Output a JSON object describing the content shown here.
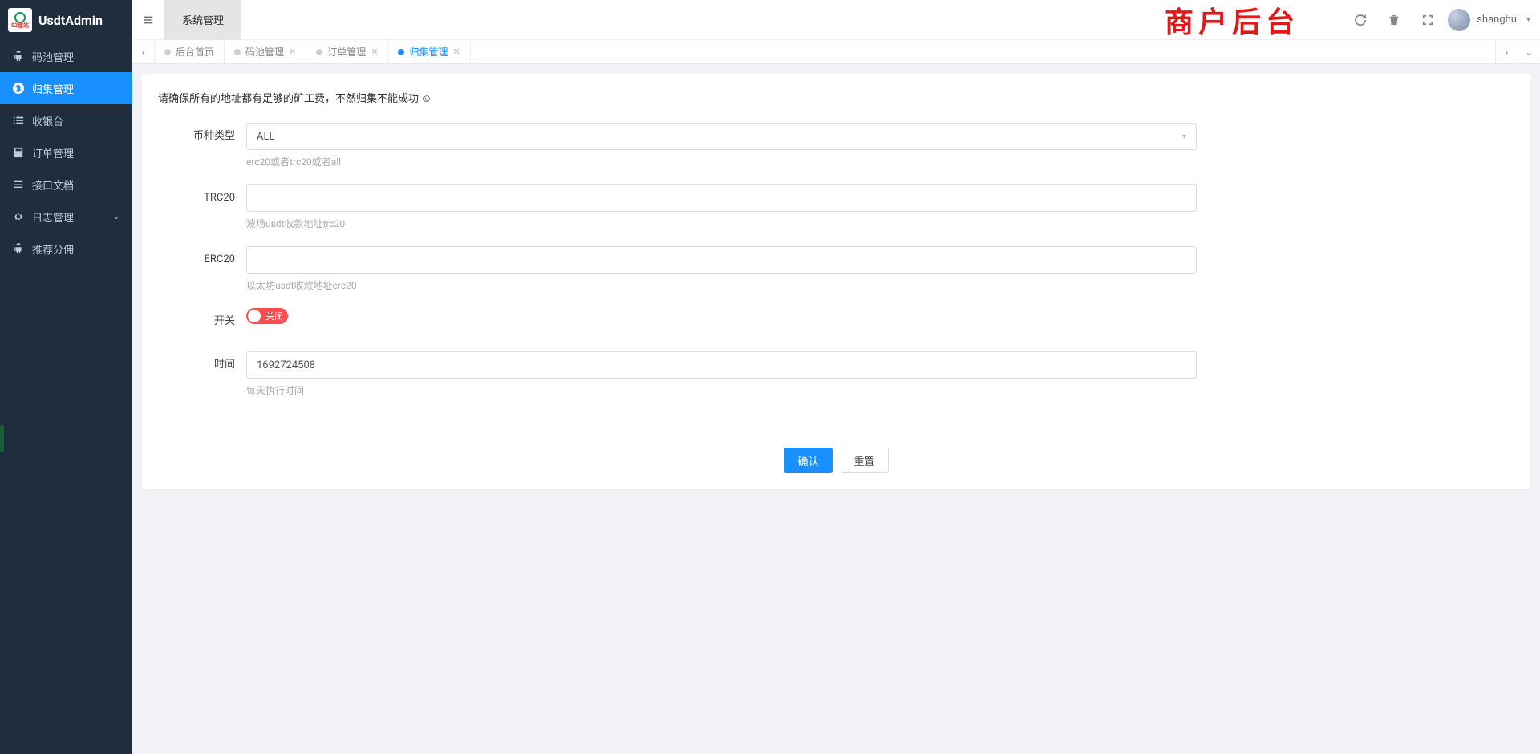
{
  "brand": "UsdtAdmin",
  "logo_sub": "92建站",
  "sidebar": {
    "items": [
      {
        "icon": "android",
        "label": "码池管理"
      },
      {
        "icon": "bitcoin",
        "label": "归集管理"
      },
      {
        "icon": "list",
        "label": "收银台"
      },
      {
        "icon": "calc",
        "label": "订单管理"
      },
      {
        "icon": "doc",
        "label": "接口文档"
      },
      {
        "icon": "gear",
        "label": "日志管理",
        "chev": true
      },
      {
        "icon": "android",
        "label": "推荐分佣"
      }
    ],
    "active_index": 1
  },
  "topbar": {
    "sys_tab": "系统管理",
    "watermark": "商户后台",
    "username": "shanghu"
  },
  "tabs": {
    "items": [
      {
        "label": "后台首页",
        "closable": false
      },
      {
        "label": "码池管理",
        "closable": true
      },
      {
        "label": "订单管理",
        "closable": true
      },
      {
        "label": "归集管理",
        "closable": true
      }
    ],
    "active_index": 3
  },
  "form": {
    "notice": "请确保所有的地址都有足够的矿工费，不然归集不能成功 ☺",
    "fields": {
      "coin_type": {
        "label": "币种类型",
        "value": "ALL",
        "help": "erc20或者trc20或者all"
      },
      "trc20": {
        "label": "TRC20",
        "value": "",
        "help": "波场usdt收款地址trc20"
      },
      "erc20": {
        "label": "ERC20",
        "value": "",
        "help": "以太坊usdt收款地址erc20"
      },
      "switch": {
        "label": "开关",
        "state_label": "关闭"
      },
      "time": {
        "label": "时间",
        "value": "1692724508",
        "help": "每天执行时间"
      }
    },
    "actions": {
      "confirm": "确认",
      "reset": "重置"
    }
  }
}
